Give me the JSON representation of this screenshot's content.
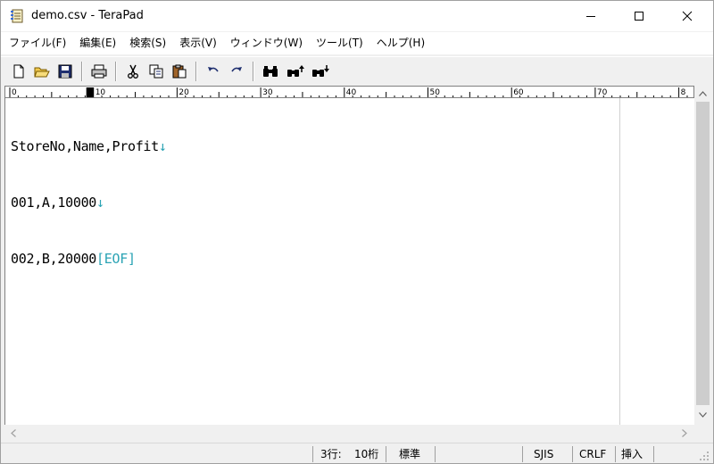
{
  "window": {
    "title": "demo.csv - TeraPad",
    "icon": "terapad-notebook-icon"
  },
  "menu": {
    "items": [
      {
        "label": "ファイル(F)"
      },
      {
        "label": "編集(E)"
      },
      {
        "label": "検索(S)"
      },
      {
        "label": "表示(V)"
      },
      {
        "label": "ウィンドウ(W)"
      },
      {
        "label": "ツール(T)"
      },
      {
        "label": "ヘルプ(H)"
      }
    ]
  },
  "toolbar": {
    "buttons": [
      {
        "icon": "new-file-icon"
      },
      {
        "icon": "open-folder-icon"
      },
      {
        "icon": "save-disk-icon"
      },
      {
        "icon": "print-icon"
      },
      {
        "icon": "cut-scissors-icon"
      },
      {
        "icon": "copy-icon"
      },
      {
        "icon": "paste-icon"
      },
      {
        "icon": "undo-icon"
      },
      {
        "icon": "redo-icon"
      },
      {
        "icon": "find-binoculars-icon"
      },
      {
        "icon": "find-prev-icon"
      },
      {
        "icon": "find-next-icon"
      }
    ]
  },
  "ruler": {
    "labels": [
      "0",
      "10",
      "20",
      "30",
      "40",
      "50",
      "60",
      "70",
      "8"
    ]
  },
  "editor": {
    "lines": [
      {
        "text": "StoreNo,Name,Profit",
        "end": "↓"
      },
      {
        "text": "001,A,10000",
        "end": "↓"
      },
      {
        "text": "002,B,20000",
        "end": "[EOF]"
      }
    ]
  },
  "status": {
    "line": "3行:",
    "column": "10桁",
    "mode": "標準",
    "encoding": "SJIS",
    "newline": "CRLF",
    "insert": "挿入"
  },
  "colors": {
    "eol_marker": "#2aa3b4",
    "background": "#ffffff",
    "chrome": "#f0f0f0"
  }
}
